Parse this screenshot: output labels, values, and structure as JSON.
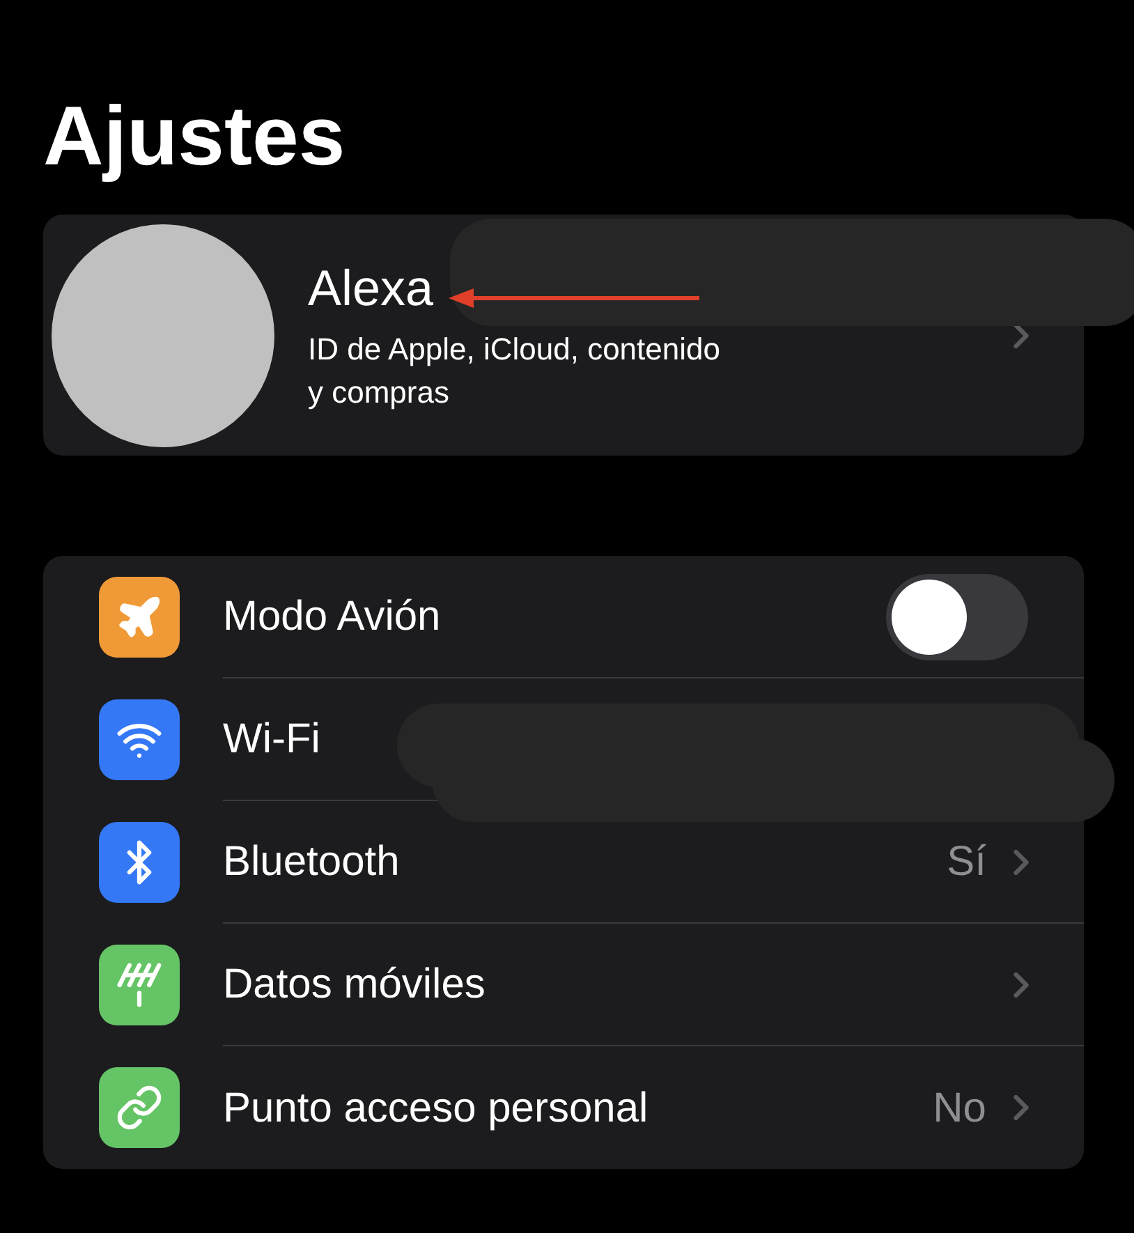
{
  "title": "Ajustes",
  "profile": {
    "name": "Alexa",
    "subtitle": "ID de Apple, iCloud, contenido y compras"
  },
  "rows": [
    {
      "kind": "toggle",
      "label": "Modo Avión",
      "color": "#f09a37",
      "on": false
    },
    {
      "kind": "plain",
      "label": "Wi-Fi",
      "color": "#3478f6"
    },
    {
      "kind": "link",
      "label": "Bluetooth",
      "color": "#3478f6",
      "value": "Sí"
    },
    {
      "kind": "link",
      "label": "Datos móviles",
      "color": "#65c466"
    },
    {
      "kind": "link",
      "label": "Punto acceso personal",
      "color": "#65c466",
      "value": "No"
    }
  ]
}
